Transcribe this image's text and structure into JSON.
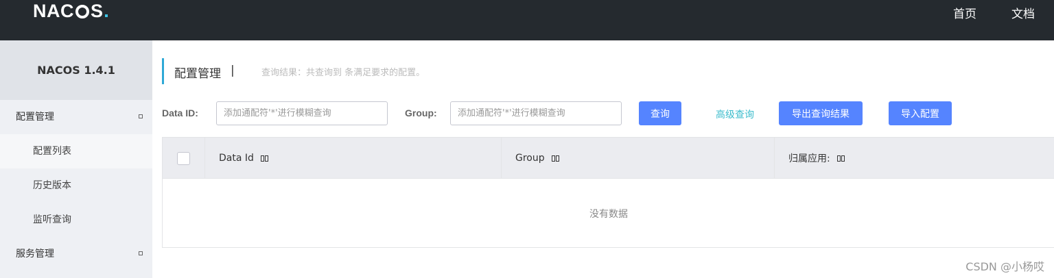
{
  "header": {
    "logo": "NACOS",
    "nav": [
      "首页",
      "文档"
    ]
  },
  "sidebar": {
    "title": "NACOS 1.4.1",
    "groups": [
      {
        "label": "配置管理",
        "items": [
          "配置列表",
          "历史版本",
          "监听查询"
        ]
      },
      {
        "label": "服务管理"
      }
    ]
  },
  "main": {
    "title": "配置管理",
    "title_sep": "|",
    "query_result": "查询结果：共查询到 条满足要求的配置。",
    "filters": {
      "data_id_label": "Data ID:",
      "data_id_placeholder": "添加通配符'*'进行模糊查询",
      "group_label": "Group:",
      "group_placeholder": "添加通配符'*'进行模糊查询"
    },
    "buttons": {
      "query": "查询",
      "advanced": "高级查询",
      "export": "导出查询结果",
      "import": "导入配置"
    },
    "table": {
      "columns": [
        "Data Id",
        "Group",
        "归属应用:"
      ],
      "empty_text": "没有数据"
    }
  },
  "watermark": "CSDN @小杨哎",
  "colors": {
    "topbar": "#252a2f",
    "primary_button": "#5584ff",
    "link": "#3cbccc",
    "title_accent": "#2ea9d6"
  }
}
